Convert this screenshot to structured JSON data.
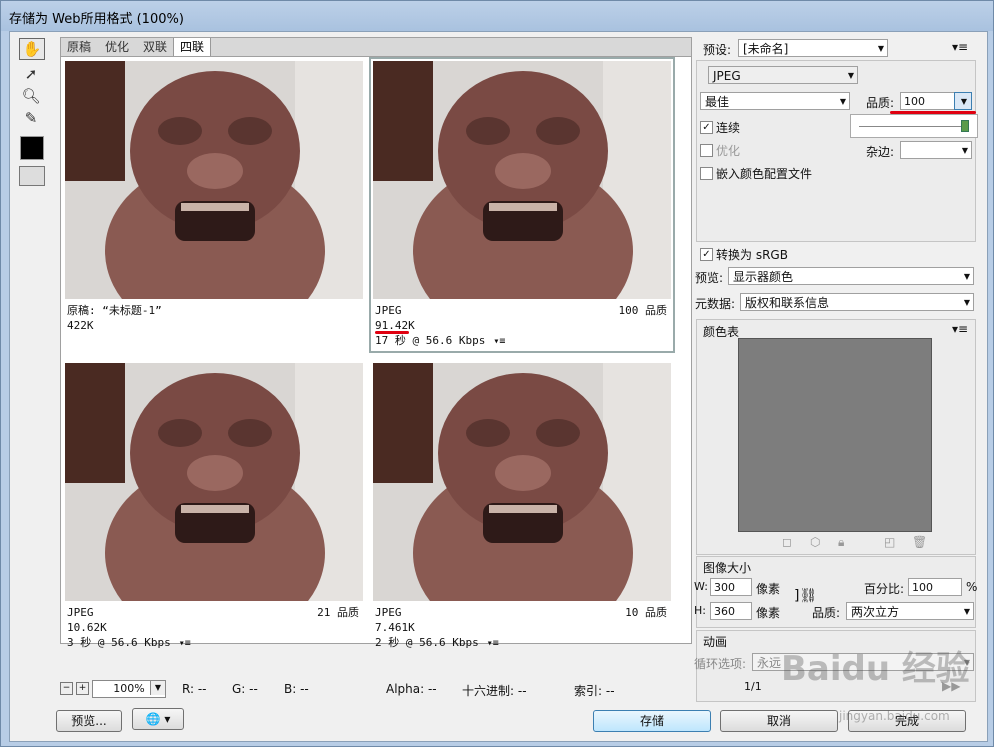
{
  "window": {
    "title": "存储为 Web所用格式 (100%)"
  },
  "tabs": [
    "原稿",
    "优化",
    "双联",
    "四联"
  ],
  "panes": [
    {
      "line1": "原稿: “未标题-1”",
      "line2": "422K",
      "line3": "",
      "quality": ""
    },
    {
      "line1": "JPEG",
      "line2": "91.42K",
      "line3": "17 秒 @ 56.6 Kbps",
      "quality": "100 品质"
    },
    {
      "line1": "JPEG",
      "line2": "10.62K",
      "line3": "3 秒 @ 56.6 Kbps",
      "quality": "21 品质"
    },
    {
      "line1": "JPEG",
      "line2": "7.461K",
      "line3": "2 秒 @ 56.6 Kbps",
      "quality": "10 品质"
    }
  ],
  "status": {
    "zoom": "100%",
    "r": "R: --",
    "g": "G: --",
    "b": "B: --",
    "alpha": "Alpha: --",
    "hex": "十六进制: --",
    "index": "索引: --"
  },
  "buttons": {
    "preview": "预览...",
    "save": "存储",
    "cancel": "取消",
    "done": "完成"
  },
  "settings": {
    "preset_label": "预设:",
    "preset_value": "[未命名]",
    "format": "JPEG",
    "compression": "最佳",
    "quality_label": "品质:",
    "quality_value": "100",
    "progressive": "连续",
    "optimized": "优化",
    "embed_profile": "嵌入颜色配置文件",
    "matte_label": "杂边:",
    "convert_srgb": "转换为 sRGB",
    "preview_label": "预览:",
    "preview_value": "显示器颜色",
    "metadata_label": "元数据:",
    "metadata_value": "版权和联系信息"
  },
  "color_table": {
    "title": "颜色表"
  },
  "image_size": {
    "title": "图像大小",
    "w_label": "W:",
    "w_value": "300",
    "w_unit": "像素",
    "h_label": "H:",
    "h_value": "360",
    "h_unit": "像素",
    "percent_label": "百分比:",
    "percent_value": "100",
    "percent_unit": "%",
    "quality_label": "品质:",
    "quality_value": "两次立方"
  },
  "animation": {
    "title": "动画",
    "loop_label": "循环选项:",
    "loop_value": "永远",
    "frame": "1/1"
  },
  "watermark": {
    "text": "Baidu 经验",
    "url": "jingyan.baidu.com"
  },
  "colors": {
    "accent_red": "#e00010",
    "color_table_bg": "#7d7d7d"
  }
}
